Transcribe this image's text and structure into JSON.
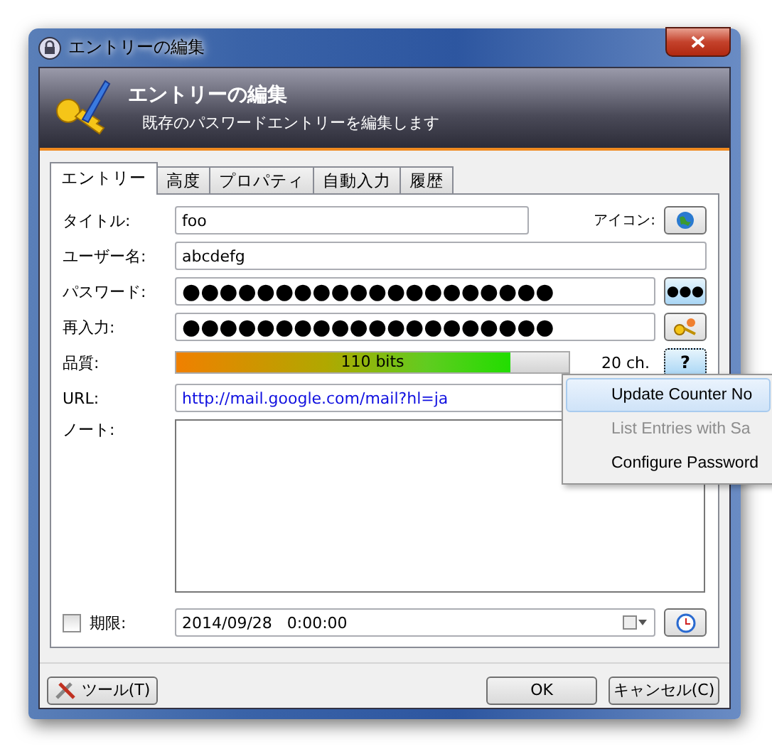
{
  "window": {
    "title": "エントリーの編集"
  },
  "banner": {
    "title": "エントリーの編集",
    "subtitle": "既存のパスワードエントリーを編集します"
  },
  "tabs": [
    {
      "label": "エントリー",
      "selected": true
    },
    {
      "label": "高度",
      "selected": false
    },
    {
      "label": "プロパティ",
      "selected": false
    },
    {
      "label": "自動入力",
      "selected": false
    },
    {
      "label": "履歴",
      "selected": false
    }
  ],
  "fields": {
    "title": {
      "label": "タイトル:",
      "value": "foo",
      "icon_label": "アイコン:"
    },
    "username": {
      "label": "ユーザー名:",
      "value": "abcdefg"
    },
    "password": {
      "label": "パスワード:",
      "value": "●●●●●●●●●●●●●●●●●●●●",
      "toggle": "●●●"
    },
    "repeat": {
      "label": "再入力:",
      "value": "●●●●●●●●●●●●●●●●●●●●"
    },
    "quality": {
      "label": "品質:",
      "level": 0.85,
      "reading": "110 bits",
      "length": "20 ch.",
      "help": "?"
    },
    "url": {
      "label": "URL:",
      "value": "http://mail.google.com/mail?hl=ja"
    },
    "notes": {
      "label": "ノート:"
    },
    "expiry": {
      "label": "期限:",
      "checked": false,
      "value": "2014/09/28   0:00:00"
    }
  },
  "menu": [
    {
      "label": "Update Counter No",
      "selected": true,
      "disabled": false
    },
    {
      "label": "List Entries with Sa",
      "selected": false,
      "disabled": true
    },
    {
      "label": "Configure Password",
      "selected": false,
      "disabled": false
    }
  ],
  "buttons": {
    "tools": "ツール(T)",
    "ok": "OK",
    "cancel": "キャンセル(C)"
  }
}
